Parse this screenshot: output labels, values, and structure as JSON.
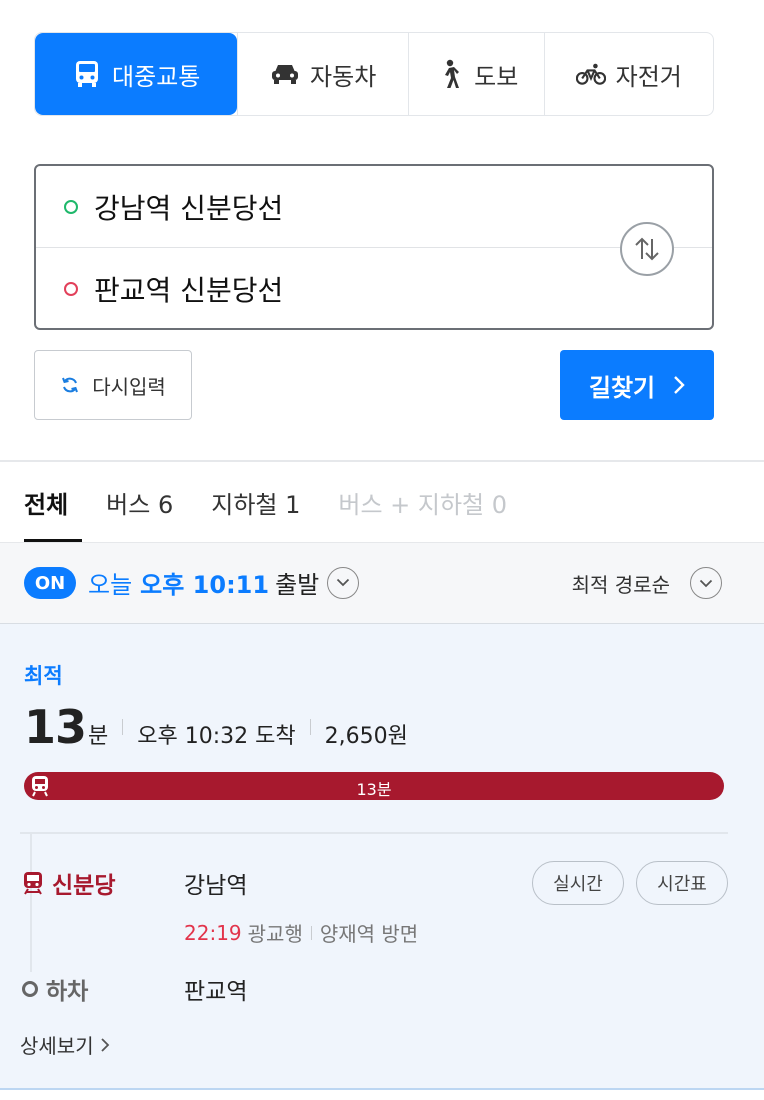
{
  "modes": [
    {
      "label": "대중교통",
      "icon": "bus-icon",
      "active": true
    },
    {
      "label": "자동차",
      "icon": "car-icon",
      "active": false
    },
    {
      "label": "도보",
      "icon": "walk-icon",
      "active": false
    },
    {
      "label": "자전거",
      "icon": "bicycle-icon",
      "active": false
    }
  ],
  "route": {
    "origin": "강남역 신분당선",
    "destination": "판교역 신분당선"
  },
  "actions": {
    "reset_label": "다시입력",
    "search_label": "길찾기"
  },
  "result_tabs": [
    {
      "label": "전체",
      "state": "active"
    },
    {
      "label": "버스 6",
      "state": "normal"
    },
    {
      "label": "지하철 1",
      "state": "normal"
    },
    {
      "label": "버스 + 지하철 0",
      "state": "disabled"
    }
  ],
  "departure": {
    "toggle": "ON",
    "day": "오늘",
    "time": "오후 10:11",
    "suffix": "출발",
    "sort": "최적 경로순"
  },
  "result": {
    "tag": "최적",
    "duration_value": "13",
    "duration_unit": "분",
    "arrival": "오후 10:32 도착",
    "fare": "2,650원",
    "timeline_label": "13분",
    "line_name": "신분당",
    "board_station": "강남역",
    "realtime_label": "실시간",
    "timetable_label": "시간표",
    "departure_time": "22:19",
    "direction": "광교행",
    "platform": "양재역 방면",
    "alight_label": "하차",
    "alight_station": "판교역",
    "more_label": "상세보기"
  },
  "colors": {
    "accent": "#0b7cff",
    "shinbundang": "#a7192e",
    "time_red": "#e2344b"
  }
}
